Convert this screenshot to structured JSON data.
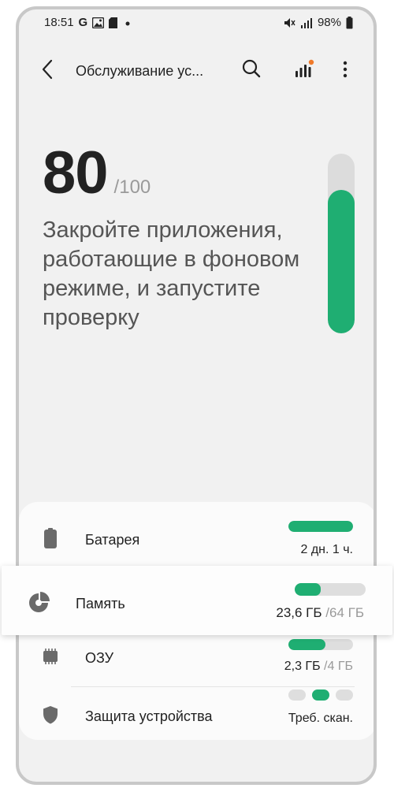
{
  "status_bar": {
    "time": "18:51",
    "letter_g": "G",
    "battery_pct": "98%"
  },
  "app_bar": {
    "title": "Обслуживание ус..."
  },
  "summary": {
    "score": "80",
    "score_max": "/100",
    "score_fraction": 0.8,
    "message": "Закройте приложения, работающие в фоновом режиме, и запустите проверку"
  },
  "items": {
    "battery": {
      "label": "Батарея",
      "value": "2 дн. 1 ч.",
      "level": 1.0
    },
    "storage": {
      "label": "Память",
      "used": "23,6 ГБ",
      "total": "/64 ГБ",
      "level": 0.37
    },
    "ram": {
      "label": "ОЗУ",
      "used": "2,3 ГБ",
      "total": "/4 ГБ",
      "level": 0.57
    },
    "security": {
      "label": "Защита устройства",
      "value": "Треб. скан.",
      "active_dot": 2
    }
  },
  "colors": {
    "accent": "#1fae72",
    "track": "#dedede",
    "badge": "#f07a2a"
  }
}
